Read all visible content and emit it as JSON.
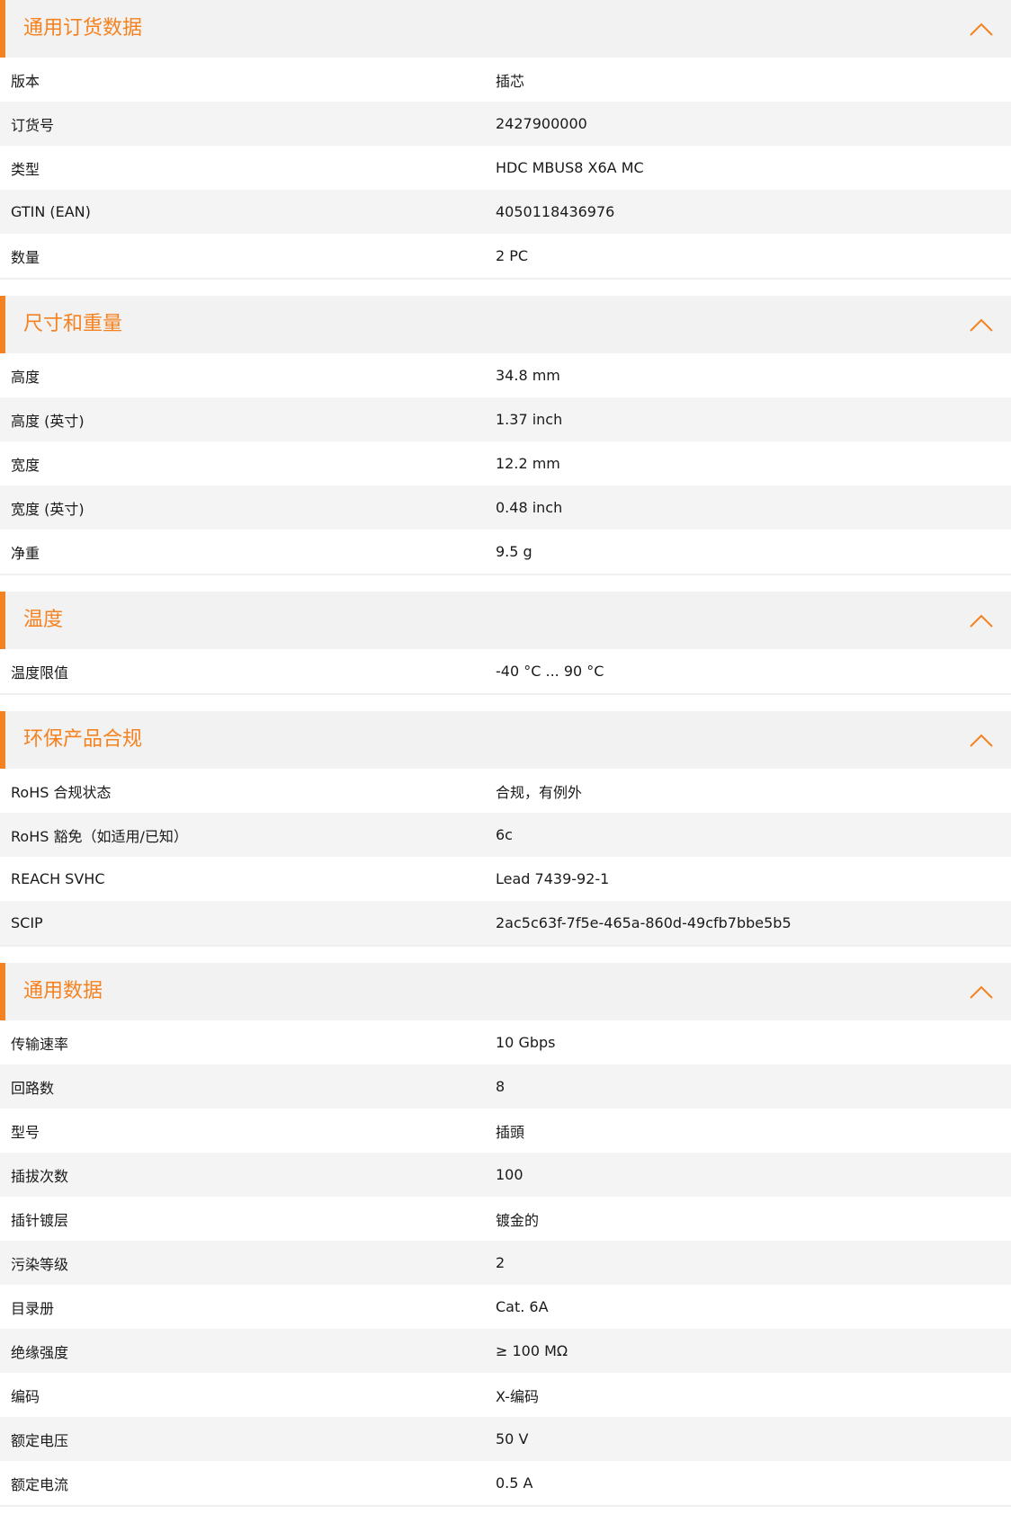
{
  "accent_color": "#f58220",
  "sections": [
    {
      "title": "通用订货数据",
      "icon": "chevron-up-icon",
      "rows": [
        {
          "label": "版本",
          "value": "插芯"
        },
        {
          "label": "订货号",
          "value": "2427900000"
        },
        {
          "label": "类型",
          "value": "HDC MBUS8 X6A MC"
        },
        {
          "label": "GTIN (EAN)",
          "value": "4050118436976"
        },
        {
          "label": "数量",
          "value": "2  PC"
        }
      ]
    },
    {
      "title": "尺寸和重量",
      "icon": "chevron-up-icon",
      "rows": [
        {
          "label": "高度",
          "value": "34.8  mm"
        },
        {
          "label": "高度 (英寸)",
          "value": "1.37  inch"
        },
        {
          "label": "宽度",
          "value": "12.2  mm"
        },
        {
          "label": "宽度 (英寸)",
          "value": "0.48  inch"
        },
        {
          "label": "净重",
          "value": "9.5  g"
        }
      ]
    },
    {
      "title": "温度",
      "icon": "chevron-up-icon",
      "rows": [
        {
          "label": "温度限值",
          "value": "-40 °C ... 90 °C"
        }
      ]
    },
    {
      "title": "环保产品合规",
      "icon": "chevron-up-icon",
      "rows": [
        {
          "label": "RoHS 合规状态",
          "value": "合规，有例外"
        },
        {
          "label": "RoHS 豁免（如适用/已知）",
          "value": "6c"
        },
        {
          "label": "REACH SVHC",
          "value": "Lead 7439-92-1"
        },
        {
          "label": "SCIP",
          "value": "2ac5c63f-7f5e-465a-860d-49cfb7bbe5b5"
        }
      ]
    },
    {
      "title": "通用数据",
      "icon": "chevron-up-icon",
      "rows": [
        {
          "label": "传输速率",
          "value": "10 Gbps"
        },
        {
          "label": "回路数",
          "value": "8"
        },
        {
          "label": "型号",
          "value": "插頭"
        },
        {
          "label": "插拔次数",
          "value": "100"
        },
        {
          "label": "插针镀层",
          "value": "镀金的"
        },
        {
          "label": "污染等级",
          "value": "2"
        },
        {
          "label": "目录册",
          "value": "Cat. 6A"
        },
        {
          "label": "绝缘强度",
          "value": "≥ 100 MΩ"
        },
        {
          "label": "编码",
          "value": "X-编码"
        },
        {
          "label": "额定电压",
          "value": "50  V"
        },
        {
          "label": "额定电流",
          "value": "0.5  A"
        }
      ]
    }
  ]
}
